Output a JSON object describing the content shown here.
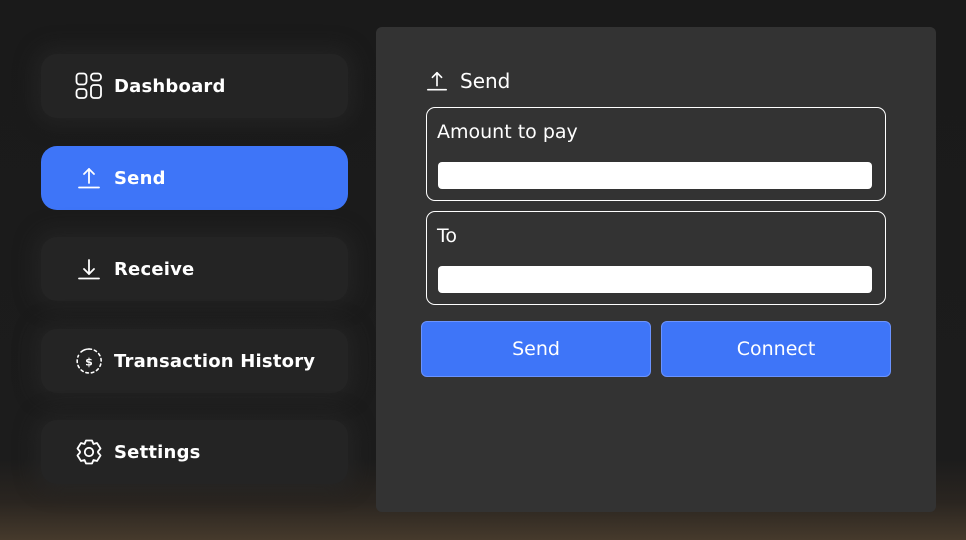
{
  "sidebar": {
    "items": [
      {
        "label": "Dashboard",
        "icon": "dashboard-grid-icon",
        "active": false
      },
      {
        "label": "Send",
        "icon": "upload-arrow-icon",
        "active": true
      },
      {
        "label": "Receive",
        "icon": "download-arrow-icon",
        "active": false
      },
      {
        "label": "Transaction History",
        "icon": "dollar-history-icon",
        "active": false
      },
      {
        "label": "Settings",
        "icon": "gear-icon",
        "active": false
      }
    ]
  },
  "panel": {
    "title": "Send",
    "title_icon": "upload-arrow-icon",
    "fields": {
      "amount": {
        "label": "Amount to pay",
        "value": ""
      },
      "to": {
        "label": "To",
        "value": ""
      }
    },
    "buttons": {
      "send": "Send",
      "connect": "Connect"
    }
  },
  "colors": {
    "accent": "#3e75f8",
    "panel_bg": "#333333",
    "nav_bg": "#242424",
    "page_bg": "#1b1b1b"
  }
}
